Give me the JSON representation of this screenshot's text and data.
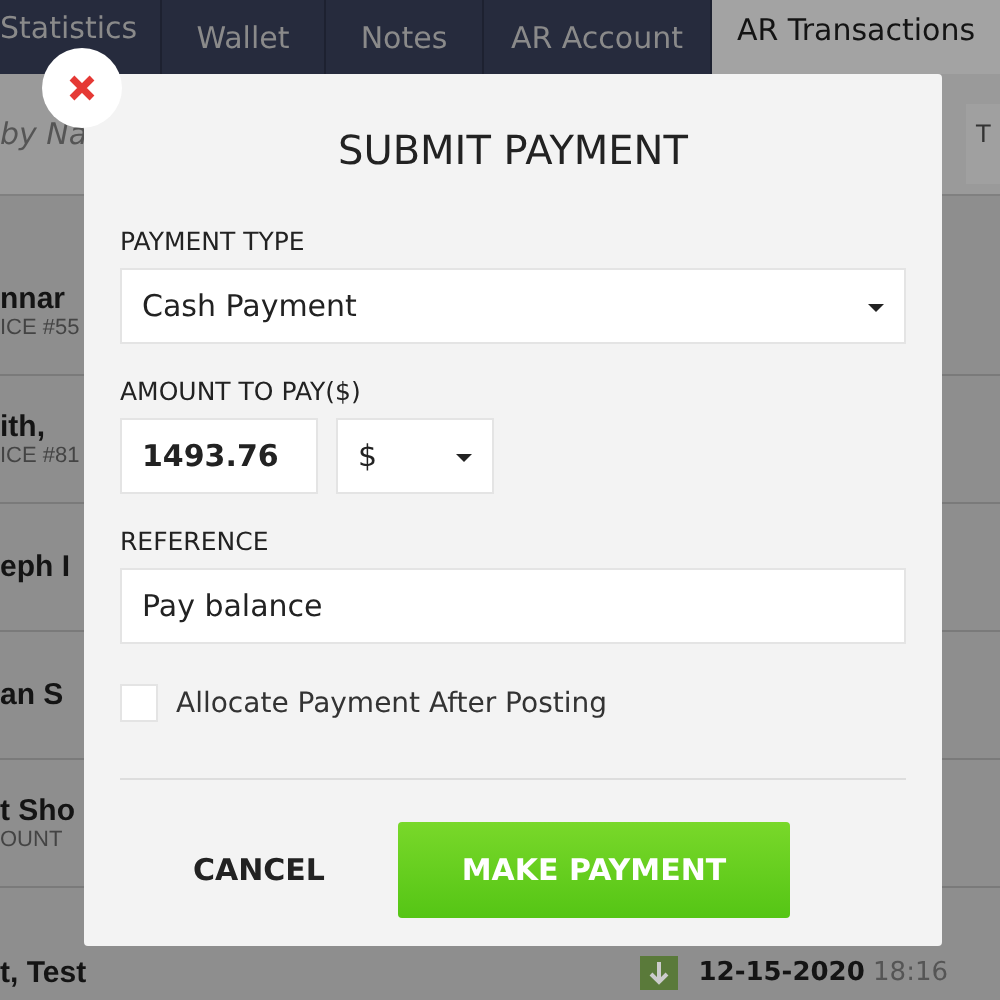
{
  "tabs": [
    {
      "label": "Statistics",
      "selected": false
    },
    {
      "label": "Wallet",
      "selected": false
    },
    {
      "label": "Notes",
      "selected": false
    },
    {
      "label": "AR Account",
      "selected": false
    },
    {
      "label": "AR Transactions",
      "selected": true
    }
  ],
  "search": {
    "placeholder": "by Na"
  },
  "filter": {
    "label": "T"
  },
  "rows": [
    {
      "name": "nnar",
      "sub": "ICE #55"
    },
    {
      "name": "ith,",
      "sub": "ICE #81"
    },
    {
      "name": "eph I"
    },
    {
      "name": "an S"
    },
    {
      "name": "t Sho",
      "sub": "OUNT"
    },
    {
      "name": "t, Test",
      "color": "#5a7a3a",
      "date": "12-15-2020",
      "time": "18:16"
    }
  ],
  "dialog": {
    "title": "SUBMIT PAYMENT",
    "payment_type": {
      "label": "PAYMENT TYPE",
      "value": "Cash Payment"
    },
    "amount": {
      "label": "AMOUNT TO PAY($)",
      "value": "1493.76",
      "currency": "$"
    },
    "reference": {
      "label": "REFERENCE",
      "value": "Pay balance"
    },
    "allocate": {
      "label": "Allocate Payment After Posting",
      "checked": false
    },
    "cancel": "CANCEL",
    "submit": "MAKE PAYMENT"
  }
}
